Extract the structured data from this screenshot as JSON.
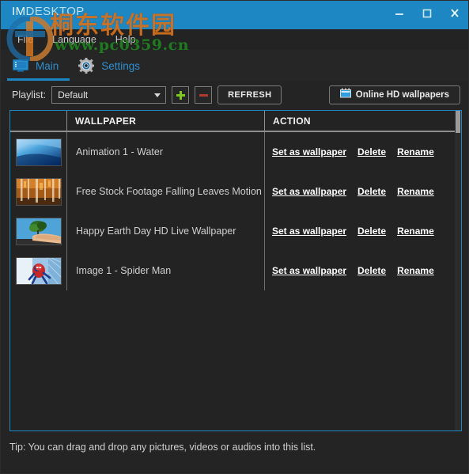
{
  "window": {
    "title_prefix": "IM",
    "title_rest": "DESKTOP",
    "title_full": "IMDESKTOP",
    "controls": {
      "minimize": "minimize-button",
      "maximize": "maximize-button",
      "close": "close-button"
    },
    "titlebar_color": "#1d87c4"
  },
  "menubar": {
    "items": [
      {
        "label": "File"
      },
      {
        "label": "Language"
      },
      {
        "label": "Help"
      }
    ]
  },
  "tabs": [
    {
      "label": "Main",
      "icon": "monitor-icon",
      "active": true
    },
    {
      "label": "Settings",
      "icon": "gear-icon",
      "active": false
    }
  ],
  "toolbar": {
    "playlist_label": "Playlist:",
    "playlist_value": "Default",
    "playlist_options": [
      "Default"
    ],
    "add_button": "+",
    "remove_button": "−",
    "refresh_label": "REFRESH",
    "online_label": "Online HD wallpapers",
    "online_icon": "globe-wallpaper-icon",
    "accent_color": "#1d87c4",
    "add_color": "#7cc820",
    "remove_color": "#b03a2e"
  },
  "table": {
    "headers": [
      "",
      "WALLPAPER",
      "ACTION"
    ],
    "actions": [
      "Set as wallpaper",
      "Delete",
      "Rename"
    ],
    "rows": [
      {
        "thumb": "underwater-blue-thumbnail",
        "name": "Animation 1 - Water"
      },
      {
        "thumb": "autumn-forest-thumbnail",
        "name": "Free Stock Footage Falling Leaves Motion Backg"
      },
      {
        "thumb": "hand-holding-tree-thumbnail",
        "name": "Happy Earth Day HD Live Wallpaper"
      },
      {
        "thumb": "spider-man-thumbnail",
        "name": "Image 1 - Spider Man"
      }
    ]
  },
  "tip": {
    "text": "Tip: You can drag and drop any pictures, videos or audios into this list."
  },
  "watermark": {
    "chinese": "桐东软件园",
    "url": "www.pc0359.cn"
  }
}
